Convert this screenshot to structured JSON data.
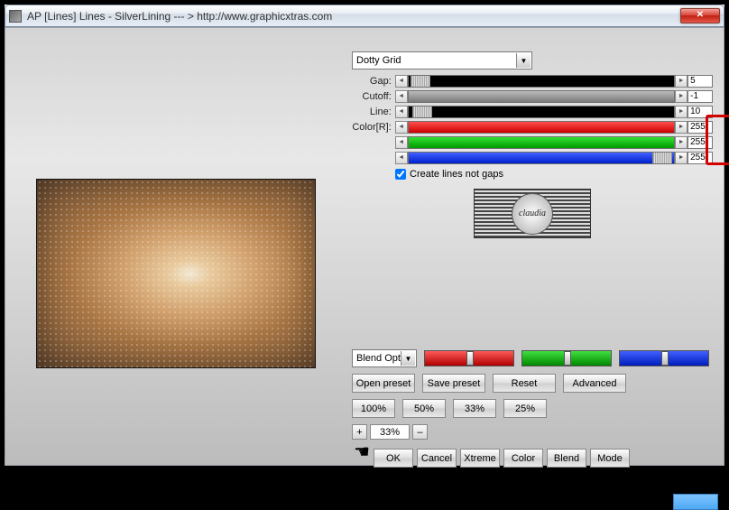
{
  "window": {
    "title": "AP [Lines]  Lines - SilverLining    --- >  http://www.graphicxtras.com",
    "close": "✕"
  },
  "preset": {
    "selected": "Dotty Grid"
  },
  "sliders": {
    "gap": {
      "label": "Gap:",
      "value": "5"
    },
    "cutoff": {
      "label": "Cutoff:",
      "value": "-1"
    },
    "line": {
      "label": "Line:",
      "value": "10"
    },
    "r": {
      "label": "Color[R]:",
      "value": "255"
    },
    "g": {
      "label": "",
      "value": "255"
    },
    "b": {
      "label": "",
      "value": "255"
    }
  },
  "check": {
    "label": "Create lines not gaps"
  },
  "logo": {
    "text": "claudia"
  },
  "blend_dropdown": "Blend Opti",
  "buttons": {
    "open_preset": "Open preset",
    "save_preset": "Save preset",
    "reset": "Reset",
    "advanced": "Advanced",
    "p100": "100%",
    "p50": "50%",
    "p33": "33%",
    "p25": "25%",
    "plus": "+",
    "minus": "–",
    "zoom_val": "33%",
    "ok": "OK",
    "cancel": "Cancel",
    "xtreme": "Xtreme",
    "color": "Color",
    "blend": "Blend",
    "mode": "Mode"
  }
}
